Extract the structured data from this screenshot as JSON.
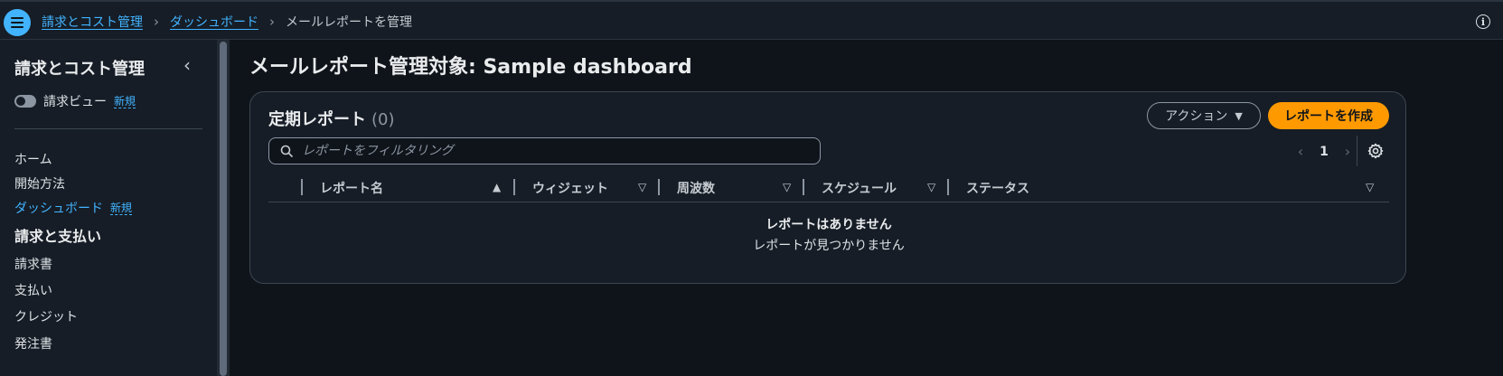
{
  "breadcrumb": {
    "items": [
      "請求とコスト管理",
      "ダッシュボード"
    ],
    "current": "メールレポートを管理"
  },
  "sidebar": {
    "title": "請求とコスト管理",
    "toggle_label": "請求ビュー",
    "new_badge": "新規",
    "items": [
      {
        "label": "ホーム"
      },
      {
        "label": "開始方法"
      },
      {
        "label": "ダッシュボード",
        "badge": "新規"
      }
    ],
    "section": "請求と支払い",
    "section_items": [
      "請求書",
      "支払い",
      "クレジット",
      "発注書"
    ]
  },
  "main": {
    "title": "メールレポート管理対象: Sample dashboard",
    "panel": {
      "title": "定期レポート",
      "count": "(0)",
      "actions_label": "アクション",
      "create_label": "レポートを作成",
      "filter_placeholder": "レポートをフィルタリング",
      "page": "1",
      "columns": [
        "レポート名",
        "ウィジェット",
        "周波数",
        "スケジュール",
        "ステータス"
      ],
      "empty_title": "レポートはありません",
      "empty_sub": "レポートが見つかりません"
    }
  },
  "colors": {
    "accent": "#42b4ff",
    "primary_button": "#ff9900",
    "background": "#0f141a",
    "surface": "#161d26"
  }
}
